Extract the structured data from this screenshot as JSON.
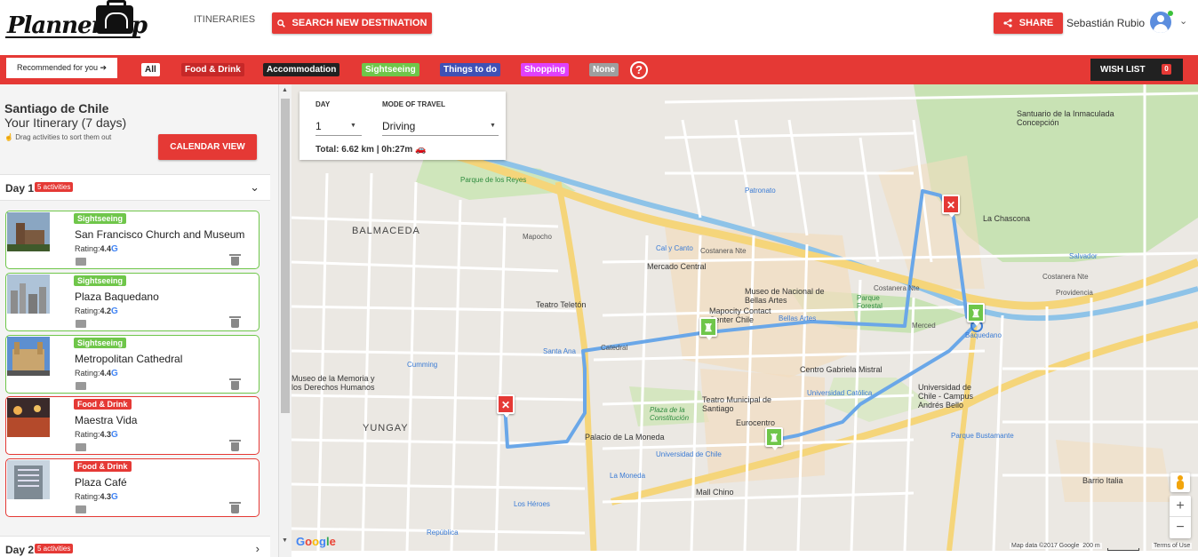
{
  "header": {
    "logo_text": "Plannertrip",
    "nav_itineraries": "ITINERARIES",
    "search_label": "SEARCH NEW DESTINATION",
    "share_label": "SHARE",
    "user_name": "Sebastián Rubio"
  },
  "filterbar": {
    "recommended_label": "Recommended for you ➔",
    "filters": [
      {
        "label": "All",
        "bg": "#ffffff",
        "fg": "#222222"
      },
      {
        "label": "Food & Drink",
        "bg": "#c62828",
        "fg": "#ffffff"
      },
      {
        "label": "Accommodation",
        "bg": "#212121",
        "fg": "#ffffff"
      },
      {
        "label": "Sightseeing",
        "bg": "#6fc64a",
        "fg": "#ffffff"
      },
      {
        "label": "Things to do",
        "bg": "#3f51b5",
        "fg": "#ffffff"
      },
      {
        "label": "Shopping",
        "bg": "#e040fb",
        "fg": "#ffffff"
      },
      {
        "label": "None",
        "bg": "#9e9e9e",
        "fg": "#ffffff"
      }
    ],
    "help_glyph": "?",
    "wishlist_label": "WISH LIST",
    "wishlist_count": "0"
  },
  "sidebar": {
    "city": "Santiago de Chile",
    "itinerary_title": "Your Itinerary (7 days)",
    "drag_hint": "Drag activities to sort them out",
    "calendar_label": "CALENDAR VIEW",
    "day1": {
      "title": "Day 1",
      "badge": "5 activities"
    },
    "day2": {
      "title": "Day 2",
      "badge": "5 activities"
    },
    "activities": [
      {
        "category": "Sightseeing",
        "name": "San Francisco Church and Museum",
        "rating_label": "Rating:",
        "rating": "4.4"
      },
      {
        "category": "Sightseeing",
        "name": "Plaza Baquedano",
        "rating_label": "Rating:",
        "rating": "4.2"
      },
      {
        "category": "Sightseeing",
        "name": "Metropolitan Cathedral",
        "rating_label": "Rating:",
        "rating": "4.4"
      },
      {
        "category": "Food & Drink",
        "name": "Maestra Vida",
        "rating_label": "Rating:",
        "rating": "4.3"
      },
      {
        "category": "Food & Drink",
        "name": "Plaza Café",
        "rating_label": "Rating:",
        "rating": "4.3"
      }
    ],
    "colors": {
      "sightseeing": "#6fc64a",
      "food": "#e53935"
    }
  },
  "map": {
    "route_panel": {
      "day_label": "DAY",
      "day_value": "1",
      "mode_label": "MODE OF TRAVEL",
      "mode_value": "Driving",
      "total": "Total: 6.62 km | 0h:27m"
    },
    "labels": {
      "balmaceda": "BALMACEDA",
      "yungay": "YUNGAY",
      "parque_de_los_reyes": "Parque de los Reyes",
      "costanera_1": "Costanera Nte",
      "costanera_2": "Costanera Nte",
      "costanera_3": "Costanera Nte",
      "providencia": "Providencia",
      "mercado_central": "Mercado Central",
      "museo_bellas_artes": "Museo de Nacional de Bellas Artes",
      "mapocho_contact": "Mapocity Contact Center Chile",
      "parque_forestal": "Parque Forestal",
      "teatro_telethon": "Teatro Teletón",
      "centro_gabriela": "Centro Gabriela Mistral",
      "teatro_municipal": "Teatro Municipal de Santiago",
      "eurocentro": "Eurocentro",
      "palacio_moneda": "Palacio de La Moneda",
      "plaza_constitucion": "Plaza de la Constitución",
      "mall_chino": "Mall Chino",
      "universidad_chile": "Universidad de Chile - Campus Andrés Bello",
      "la_chascona": "La Chascona",
      "santuario": "Santuario de la Inmaculada Concepción",
      "museo_memoria": "Museo de la Memoria y los Derechos Humanos",
      "barrio_italia": "Barrio Italia",
      "cal_y_canto": "Cal y Canto",
      "bellas_artes_metro": "Bellas Artes",
      "santa_ana": "Santa Ana",
      "cumming": "Cumming",
      "universidad_catolica": "Universidad Católica",
      "baquedano": "Baquedano",
      "salvador": "Salvador",
      "la_moneda": "La Moneda",
      "los_heroes": "Los Héroes",
      "parque_bustamante": "Parque Bustamante",
      "republica": "República",
      "universidad_de_chile_metro": "Universidad de Chile",
      "patronato": "Patronato",
      "mapocho": "Mapocho",
      "mercado": "Merced",
      "catedral": "Catedral"
    },
    "attribution": "Map data ©2017 Google",
    "scale": "200 m",
    "terms": "Terms of Use",
    "google": [
      "G",
      "o",
      "o",
      "g",
      "l",
      "e"
    ],
    "google_colors": [
      "#4285f4",
      "#ea4335",
      "#fbbc05",
      "#4285f4",
      "#34a853",
      "#ea4335"
    ],
    "route_color": "#6aa7e8"
  }
}
